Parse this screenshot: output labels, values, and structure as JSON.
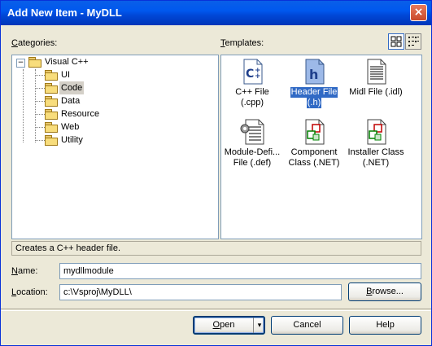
{
  "window": {
    "title": "Add New Item - MyDLL",
    "close_label": "×"
  },
  "categories": {
    "label_u": "C",
    "label_rest": "ategories:",
    "root": {
      "expander": "−",
      "label": "Visual C++"
    },
    "items": [
      {
        "label": "UI"
      },
      {
        "label": "Code",
        "selected": true
      },
      {
        "label": "Data"
      },
      {
        "label": "Resource"
      },
      {
        "label": "Web"
      },
      {
        "label": "Utility"
      }
    ]
  },
  "templates": {
    "label_u": "T",
    "label_rest": "emplates:",
    "items": [
      {
        "line1": "C++ File",
        "line2": "(.cpp)",
        "icon": "cpp-file-icon"
      },
      {
        "line1": "Header File",
        "line2": "(.h)",
        "icon": "header-file-icon",
        "selected": true
      },
      {
        "line1": "Midl File (.idl)",
        "line2": "",
        "icon": "midl-file-icon"
      },
      {
        "line1": "Module-Defi...",
        "line2": "File (.def)",
        "icon": "module-definition-icon"
      },
      {
        "line1": "Component",
        "line2": "Class (.NET)",
        "icon": "component-class-icon"
      },
      {
        "line1": "Installer Class",
        "line2": "(.NET)",
        "icon": "installer-class-icon"
      }
    ]
  },
  "status": "Creates a C++ header file.",
  "name": {
    "label_u": "N",
    "label_rest": "ame:",
    "value": "mydllmodule"
  },
  "location": {
    "label_u": "L",
    "label_rest": "ocation:",
    "value": "c:\\Vsproj\\MyDLL\\"
  },
  "buttons": {
    "browse_u": "B",
    "browse_rest": "rowse...",
    "open_u": "O",
    "open_rest": "pen",
    "open_arrow": "▾",
    "cancel": "Cancel",
    "help": "Help"
  },
  "colors": {
    "title_bar": "#0054E3",
    "selection": "#316AC5",
    "dialog_bg": "#ECE9D8"
  }
}
